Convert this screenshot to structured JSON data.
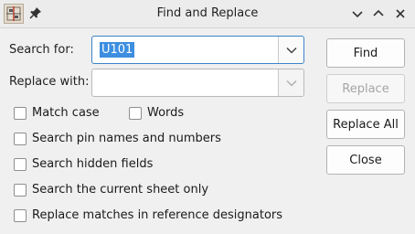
{
  "window": {
    "title": "Find and Replace"
  },
  "form": {
    "search_label": "Search for:",
    "search_value": "U101",
    "replace_label": "Replace with:",
    "replace_value": ""
  },
  "options": {
    "match_case": {
      "label": "Match case",
      "checked": false
    },
    "words": {
      "label": "Words",
      "checked": false
    },
    "search_pins": {
      "label": "Search pin names and numbers",
      "checked": false
    },
    "search_hidden": {
      "label": "Search hidden fields",
      "checked": false
    },
    "current_sheet": {
      "label": "Search the current sheet only",
      "checked": false
    },
    "replace_refdes": {
      "label": "Replace matches in reference designators",
      "checked": false
    }
  },
  "buttons": {
    "find": "Find",
    "replace": "Replace",
    "replace_all": "Replace All",
    "close": "Close"
  },
  "colors": {
    "selection": "#3d8ee0",
    "focus_border": "#3b84c9",
    "disabled_text": "#a5a5a5"
  }
}
